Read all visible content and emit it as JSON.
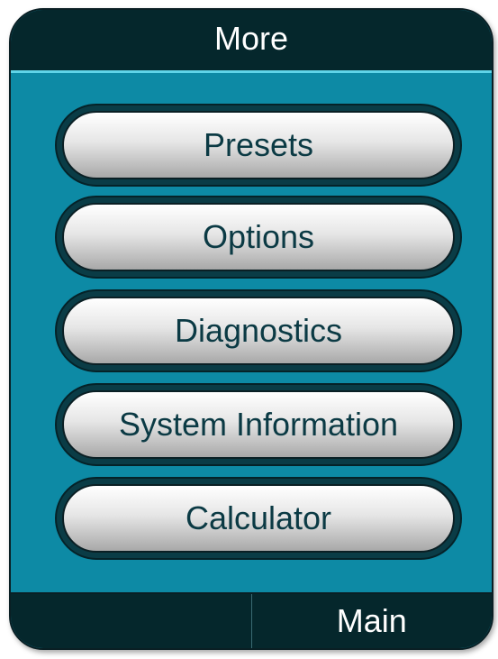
{
  "header": {
    "title": "More"
  },
  "menu": {
    "items": [
      {
        "label": "Presets"
      },
      {
        "label": "Options"
      },
      {
        "label": "Diagnostics"
      },
      {
        "label": "System Information"
      },
      {
        "label": "Calculator"
      }
    ]
  },
  "footer": {
    "left_key_label": "",
    "right_key_label": "Main"
  },
  "colors": {
    "panel_background": "#0d8aa5",
    "bar_background": "#05272c",
    "title_underline": "#5fd4e8",
    "button_text": "#0b3a44"
  }
}
